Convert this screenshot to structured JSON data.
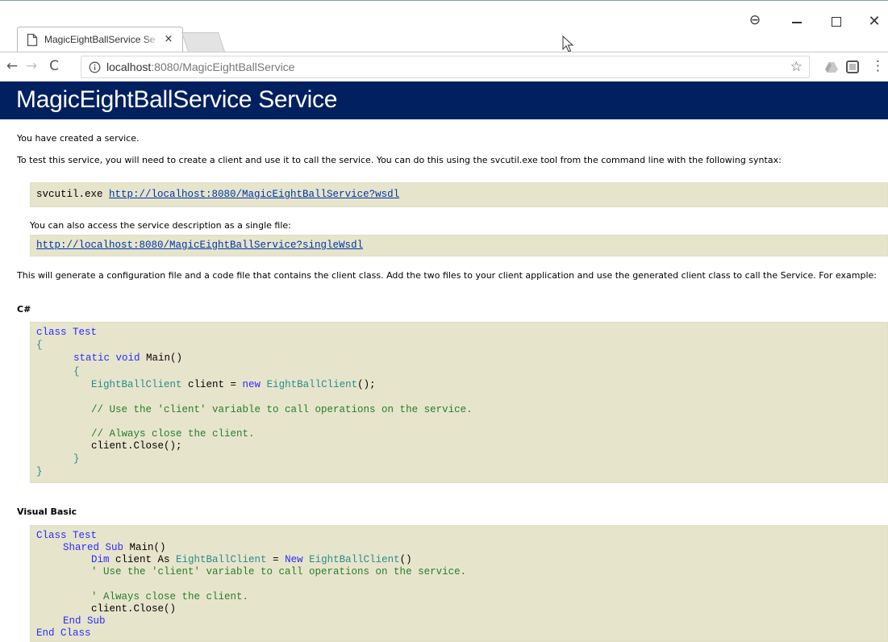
{
  "browser": {
    "tab_title": "MagicEightBallService Se",
    "tab_close": "×",
    "url_host": "localhost",
    "url_rest": ":8080/MagicEightBallService",
    "nav_back": "←",
    "nav_forward": "→",
    "nav_reload": "C",
    "star": "☆",
    "menu": "⋮",
    "window_account": "⊖",
    "window_close": "✕"
  },
  "page": {
    "heading": "MagicEightBallService Service",
    "created_text": "You have created a service.",
    "test_text": "To test this service, you will need to create a client and use it to call the service. You can do this using the svcutil.exe tool from the command line with the following syntax:",
    "svcutil_prefix": "svcutil.exe ",
    "wsdl_link": "http://localhost:8080/MagicEightBallService?wsdl",
    "single_file_text": "You can also access the service description as a single file:",
    "single_wsdl_link": "http://localhost:8080/MagicEightBallService?singleWsdl",
    "generate_text": "This will generate a configuration file and a code file that contains the client class. Add the two files to your client application and use the generated client class to call the Service. For example:",
    "csharp_label": "C#",
    "vb_label": "Visual Basic",
    "csharp": {
      "kw_class": "class",
      "name_test": " Test",
      "open_brace": "{",
      "kw_static": "static",
      "kw_void": "void",
      "main": " Main()",
      "inner_open": "{",
      "type_client": "EightBallClient",
      "client_decl": " client = ",
      "kw_new": "new",
      "ctor": " EightBallClient",
      "ctor_end": "();",
      "comment_use": "// Use the 'client' variable to call operations on the service.",
      "comment_close": "// Always close the client.",
      "close_call": "client.Close();",
      "inner_close": "}",
      "close_brace": "}"
    },
    "vb": {
      "kw_class": "Class",
      "name_test": " Test",
      "kw_shared_sub": "Shared Sub",
      "main": " Main()",
      "kw_dim": "Dim",
      "client_as": " client As ",
      "type_client": "EightBallClient",
      "equals": " = ",
      "kw_new": "New",
      "ctor": " EightBallClient",
      "ctor_end": "()",
      "comment_use": "' Use the 'client' variable to call operations on the service.",
      "comment_close": "' Always close the client.",
      "close_call": "client.Close()",
      "end_sub": "End Sub",
      "end_class": "End Class"
    }
  }
}
